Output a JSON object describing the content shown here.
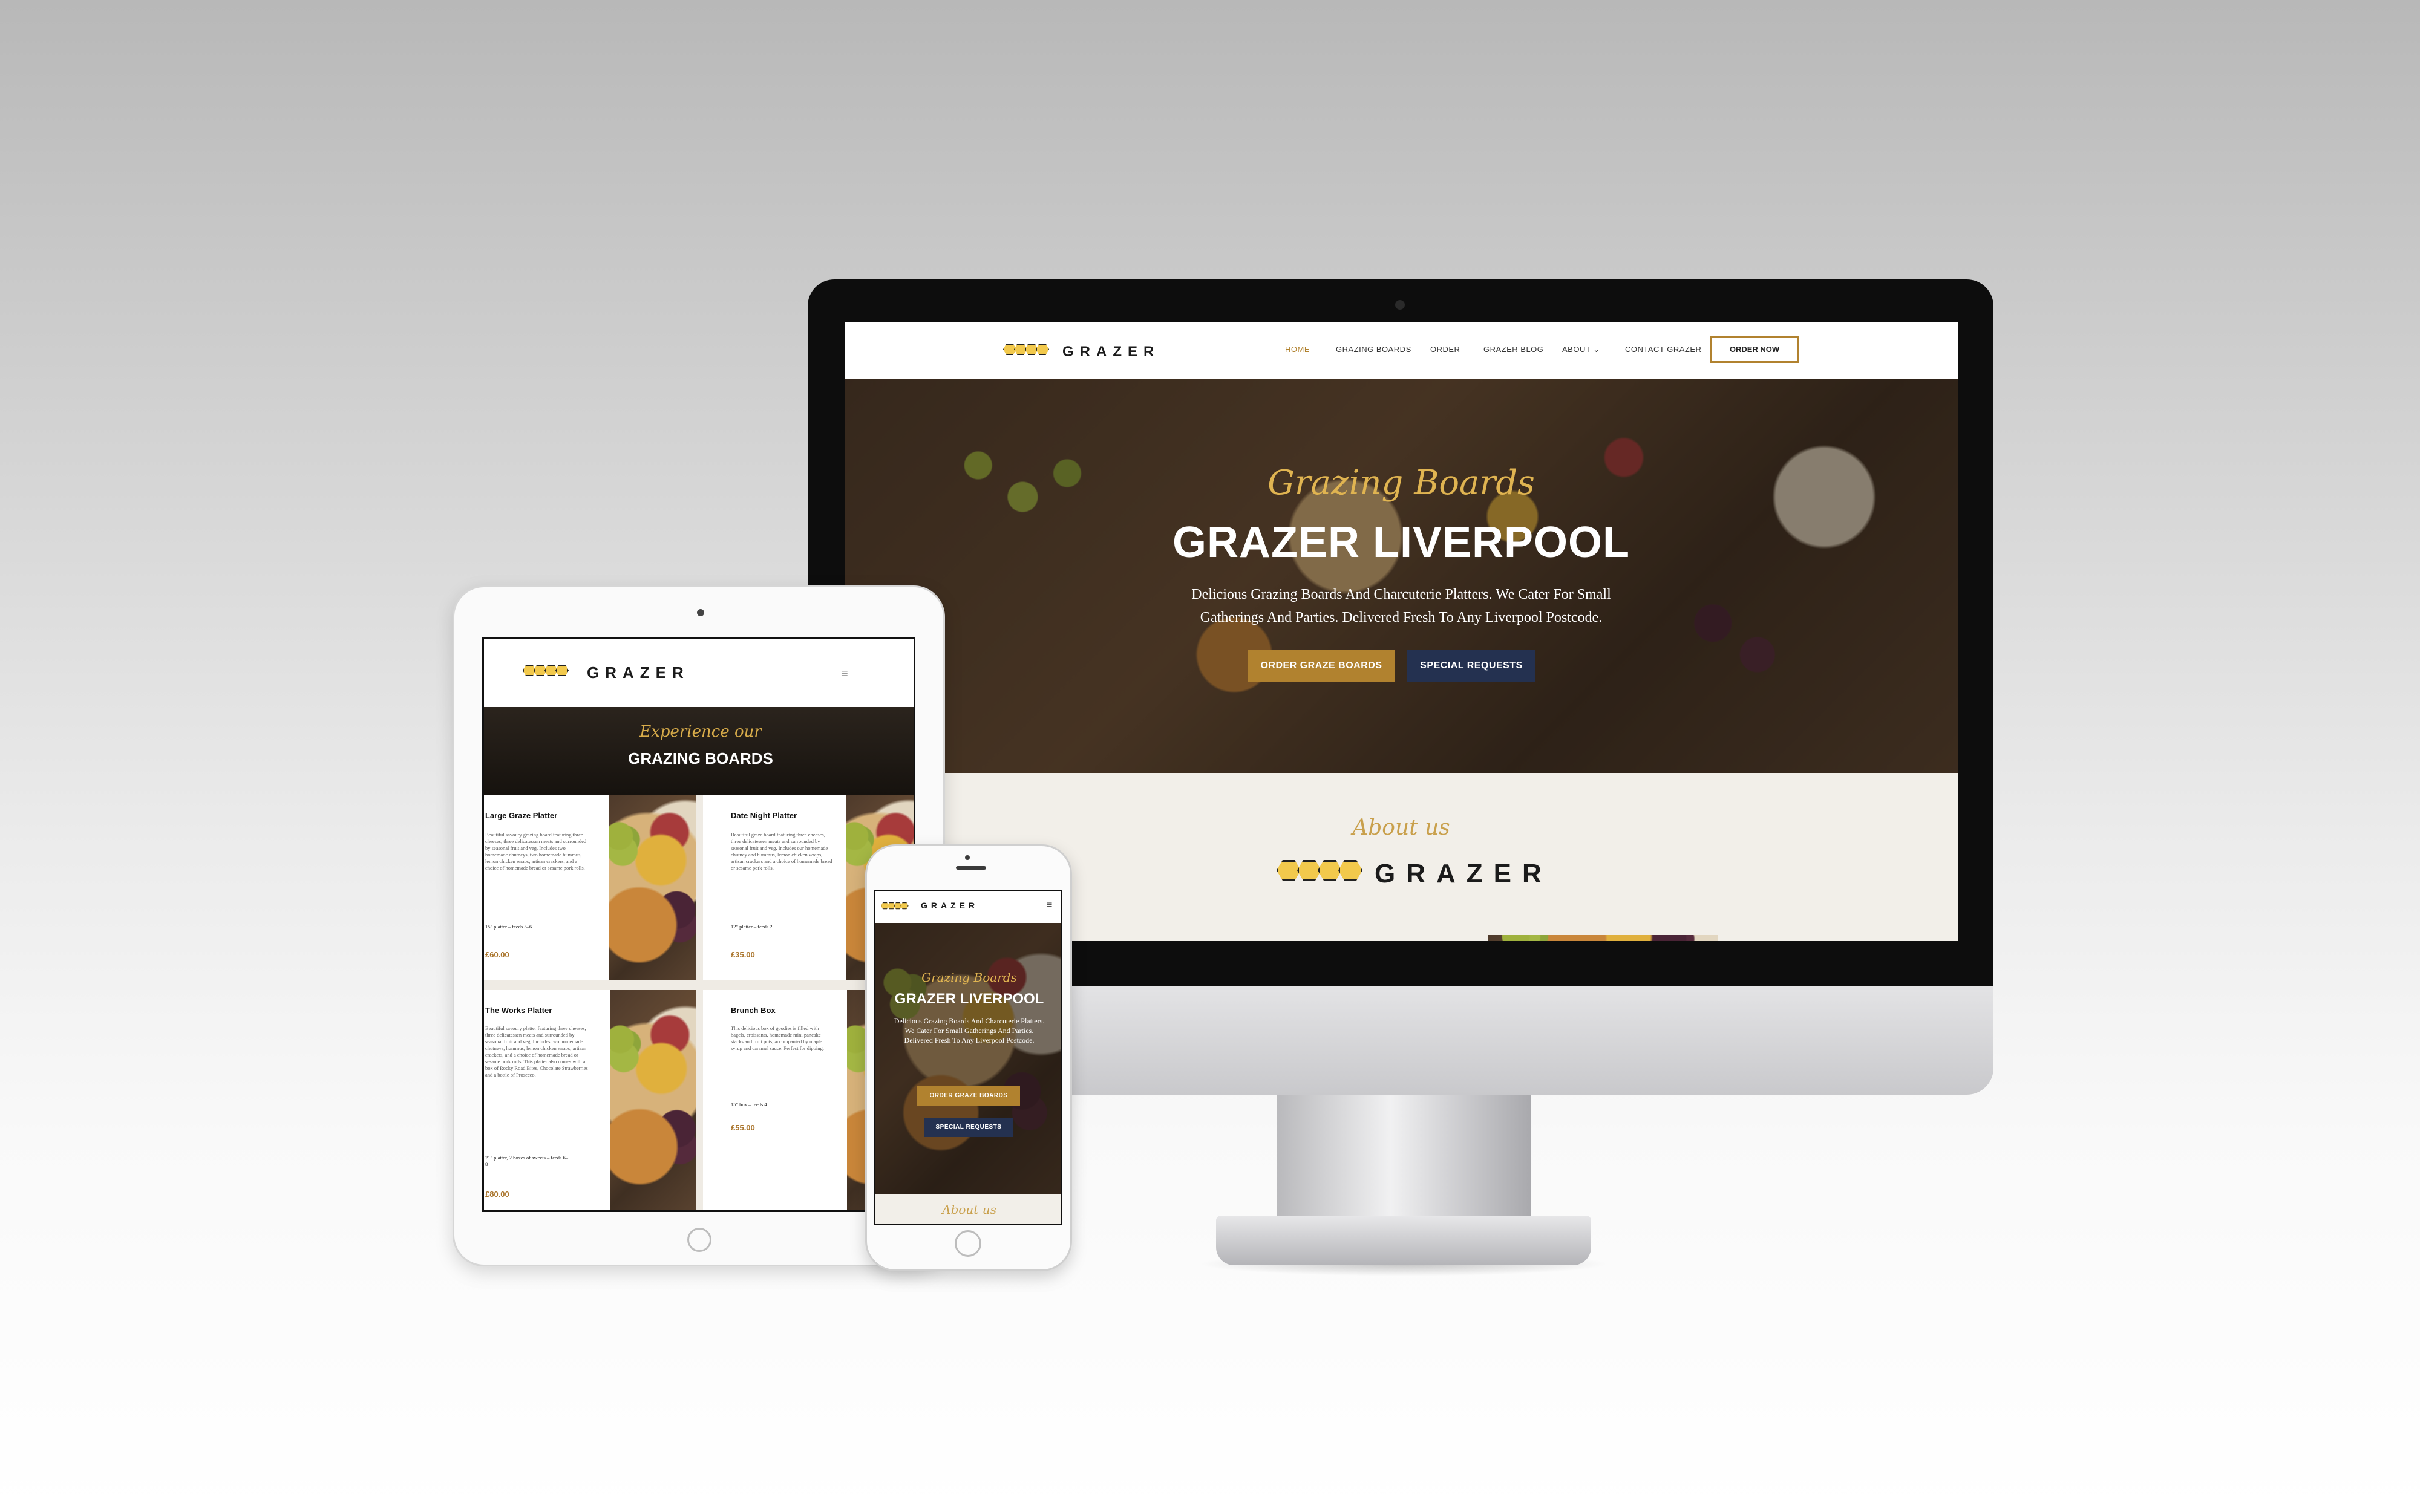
{
  "brand": {
    "logo_text": "GRAZER",
    "accent_gold": "#b1822f",
    "honey_yellow": "#f2c94c",
    "navy": "#243150"
  },
  "desktop": {
    "nav": {
      "items": [
        "HOME",
        "GRAZING BOARDS",
        "ORDER",
        "GRAZER BLOG",
        "ABOUT ⌄",
        "CONTACT GRAZER"
      ],
      "cta": "ORDER NOW"
    },
    "hero": {
      "script_title": "Grazing Boards",
      "title": "GRAZER LIVERPOOL",
      "subtitle_line1": "Delicious Grazing Boards And Charcuterie Platters. We Cater For Small",
      "subtitle_line2": "Gatherings And Parties. Delivered Fresh To Any Liverpool Postcode.",
      "primary_button": "ORDER GRAZE BOARDS",
      "secondary_button": "SPECIAL REQUESTS"
    },
    "about": {
      "script_title": "About us",
      "logo_text": "GRAZER"
    }
  },
  "tablet": {
    "logo_text": "GRAZER",
    "menu_icon": "hamburger-icon",
    "banner_script": "Experience our",
    "banner_title": "GRAZING BOARDS",
    "products": [
      {
        "title": "Large Graze Platter",
        "desc": "Beautiful savoury grazing board featuring three cheeses, three delicatessen meats and surrounded by seasonal fruit and veg. Includes two homemade chutneys, two homemade hummus, lemon chicken wraps, artisan crackers, and a choice of homemade bread or sesame pork rolls.",
        "size": "15\" platter – feeds 5–6",
        "price": "£60.00"
      },
      {
        "title": "Date Night Platter",
        "desc": "Beautiful graze board featuring three cheeses, three delicatessen meats and surrounded by seasonal fruit and veg. Includes our homemade chutney and hummus, lemon chicken wraps, artisan crackers and a choice of homemade bread or sesame pork rolls.",
        "size": "12\" platter – feeds 2",
        "price": "£35.00"
      },
      {
        "title": "The Works Platter",
        "desc": "Beautiful savoury platter featuring three cheeses, three delicatessen meats and surrounded by seasonal fruit and veg. Includes two homemade chutneys, hummus, lemon chicken wraps, artisan crackers, and a choice of homemade bread or sesame pork rolls. This platter also comes with a box of Rocky Road Bites, Chocolate Strawberries and a bottle of Prosecco.",
        "size": "21\" platter, 2 boxes of sweets – feeds 6–8",
        "price": "£80.00"
      },
      {
        "title": "Brunch Box",
        "desc": "This delicious box of goodies is filled with bagels, croissants, homemade mini pancake stacks and fruit pots, accompanied by maple syrup and caramel sauce. Perfect for dipping.",
        "size": "15\" box – feeds 4",
        "price": "£55.00"
      }
    ]
  },
  "phone": {
    "logo_text": "GRAZER",
    "menu_icon": "hamburger-icon",
    "script_title": "Grazing Boards",
    "title": "GRAZER LIVERPOOL",
    "subtitle": "Delicious Grazing Boards And Charcuterie Platters. We Cater For Small Gatherings And Parties. Delivered Fresh To Any Liverpool Postcode.",
    "primary_button": "ORDER GRAZE BOARDS",
    "secondary_button": "SPECIAL REQUESTS",
    "about_script": "About us"
  }
}
